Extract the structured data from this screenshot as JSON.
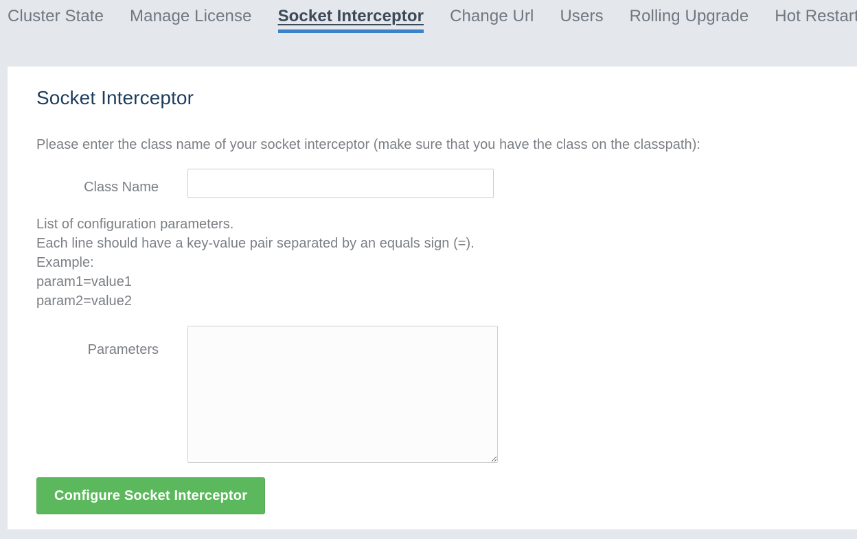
{
  "nav": {
    "tabs": [
      {
        "label": "Cluster State",
        "active": false
      },
      {
        "label": "Manage License",
        "active": false
      },
      {
        "label": "Socket Interceptor",
        "active": true
      },
      {
        "label": "Change Url",
        "active": false
      },
      {
        "label": "Users",
        "active": false
      },
      {
        "label": "Rolling Upgrade",
        "active": false
      },
      {
        "label": "Hot Restart",
        "active": false
      }
    ]
  },
  "page": {
    "title": "Socket Interceptor",
    "lead": "Please enter the class name of your socket interceptor (make sure that you have the class on the classpath):"
  },
  "form": {
    "class_name": {
      "label": "Class Name",
      "value": "",
      "placeholder": ""
    },
    "helper_lines": [
      "List of configuration parameters.",
      "Each line should have a key-value pair separated by an equals sign (=).",
      "Example:",
      "param1=value1",
      "param2=value2"
    ],
    "parameters": {
      "label": "Parameters",
      "value": "",
      "placeholder": ""
    },
    "submit_label": "Configure Socket Interceptor"
  },
  "colors": {
    "page_background": "#e4e7eb",
    "card_background": "#ffffff",
    "title": "#1d3c5c",
    "body_text": "#7b7f84",
    "tab_inactive": "#6f7780",
    "tab_active": "#3c4a57",
    "tab_underline": "#3d81c9",
    "button_green": "#5cb85c",
    "input_border": "#cccccc"
  }
}
